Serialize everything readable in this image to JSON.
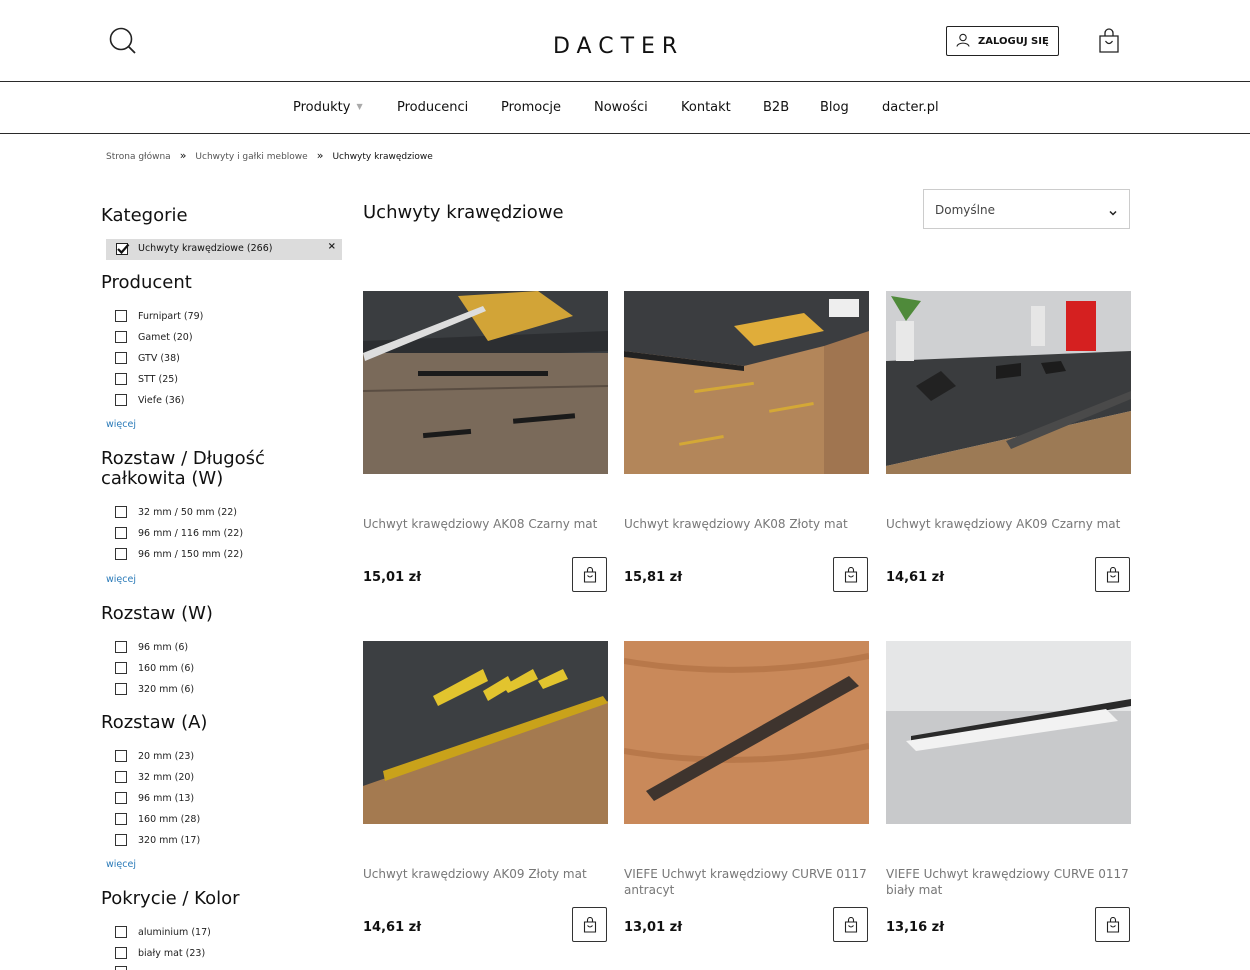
{
  "header": {
    "logo": "DACTER",
    "login_label": "ZALOGUJ SIĘ"
  },
  "nav": {
    "items": [
      "Produkty",
      "Producenci",
      "Promocje",
      "Nowości",
      "Kontakt",
      "B2B",
      "Blog",
      "dacter.pl"
    ]
  },
  "breadcrumb": {
    "items": [
      "Strona główna",
      "Uchwyty i gałki meblowe",
      "Uchwyty krawędziowe"
    ],
    "separator": "»"
  },
  "sidebar": {
    "categories": {
      "title": "Kategorie",
      "active": "Uchwyty krawędziowe (266)",
      "remove": "×"
    },
    "producent": {
      "title": "Producent",
      "options": [
        "Furnipart (79)",
        "Gamet (20)",
        "GTV (38)",
        "STT (25)",
        "Viefe (36)"
      ],
      "more": "więcej"
    },
    "rozstaw_dlugosc": {
      "title_line1": "Rozstaw / Długość",
      "title_line2": "całkowita (W)",
      "options": [
        "32 mm / 50 mm (22)",
        "96 mm / 116 mm (22)",
        "96 mm / 150 mm (22)"
      ],
      "more": "więcej"
    },
    "rozstaw_w": {
      "title": "Rozstaw (W)",
      "options": [
        "96 mm (6)",
        "160 mm (6)",
        "320 mm (6)"
      ]
    },
    "rozstaw_a": {
      "title": "Rozstaw (A)",
      "options": [
        "20 mm (23)",
        "32 mm (20)",
        "96 mm (13)",
        "160 mm (28)",
        "320 mm (17)"
      ],
      "more": "więcej"
    },
    "pokrycie": {
      "title": "Pokrycie / Kolor",
      "options": [
        "aluminium (17)",
        "biały mat (23)"
      ]
    }
  },
  "main": {
    "title": "Uchwyty krawędziowe",
    "sort_value": "Domyślne",
    "products": [
      {
        "name": "Uchwyt krawędziowy AK08 Czarny mat",
        "price": "15,01 zł"
      },
      {
        "name": "Uchwyt krawędziowy AK08 Złoty mat",
        "price": "15,81 zł"
      },
      {
        "name": "Uchwyt krawędziowy AK09 Czarny mat",
        "price": "14,61 zł"
      },
      {
        "name": "Uchwyt krawędziowy AK09 Złoty mat",
        "price": "14,61 zł"
      },
      {
        "name": "VIEFE Uchwyt krawędziowy CURVE 0117 antracyt",
        "price": "13,01 zł"
      },
      {
        "name": "VIEFE Uchwyt krawędziowy CURVE 0117 biały mat",
        "price": "13,16 zł"
      }
    ]
  },
  "colors": {
    "link": "#2a7ab8",
    "active_bg": "#dcdcdc",
    "border": "#2a2a2a"
  }
}
